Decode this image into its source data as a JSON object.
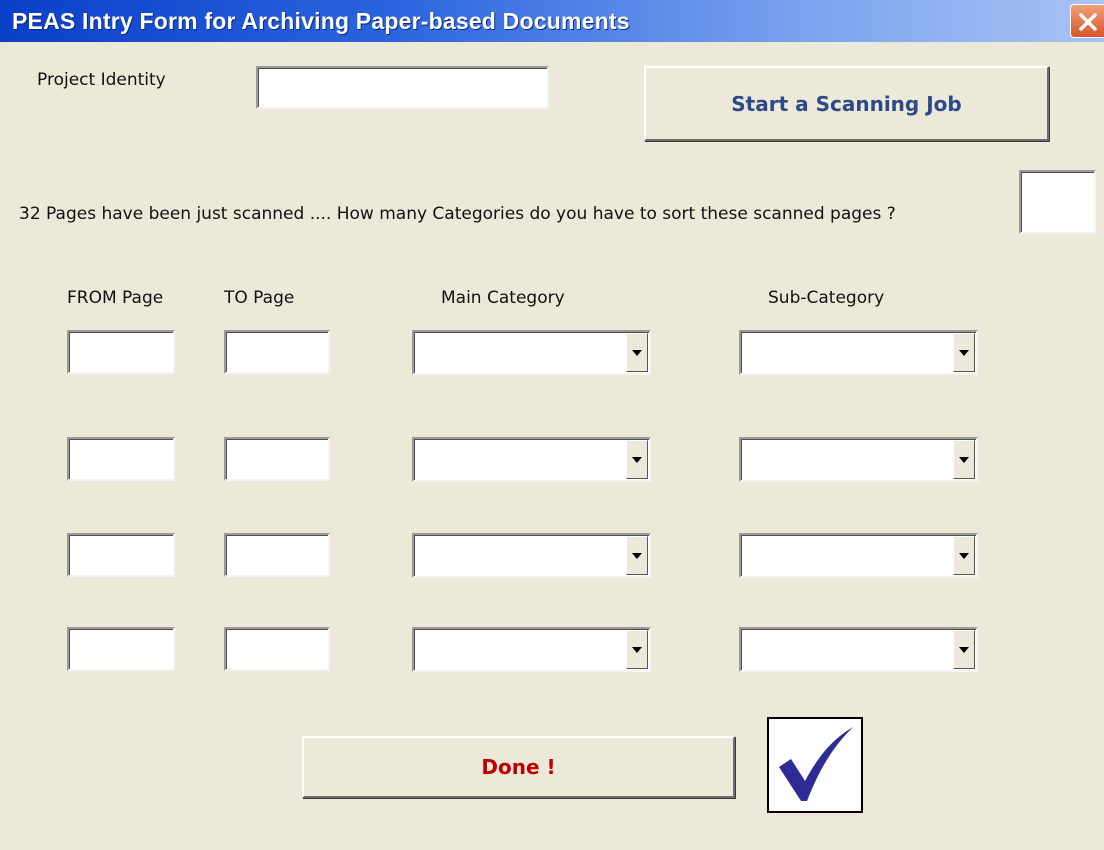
{
  "window": {
    "title": "PEAS Intry Form for Archiving Paper-based Documents",
    "close_icon": "close-x-icon"
  },
  "project": {
    "label": "Project Identity",
    "value": ""
  },
  "scan_button": {
    "label": "Start a Scanning Job",
    "color": "#2c4a8a"
  },
  "question": {
    "text": "32 Pages have been just scanned .... How many Categories do you have to sort these scanned pages ?",
    "answer": ""
  },
  "columns": {
    "from_page": "FROM Page",
    "to_page": "TO Page",
    "main_category": "Main Category",
    "sub_category": "Sub-Category"
  },
  "rows": [
    {
      "from": "",
      "to": "",
      "main": "",
      "sub": ""
    },
    {
      "from": "",
      "to": "",
      "main": "",
      "sub": ""
    },
    {
      "from": "",
      "to": "",
      "main": "",
      "sub": ""
    },
    {
      "from": "",
      "to": "",
      "main": "",
      "sub": ""
    }
  ],
  "done_button": {
    "label": "Done !",
    "color": "#c00000"
  },
  "confirm_icon": {
    "name": "checkmark-icon",
    "color": "#2c2c94"
  }
}
